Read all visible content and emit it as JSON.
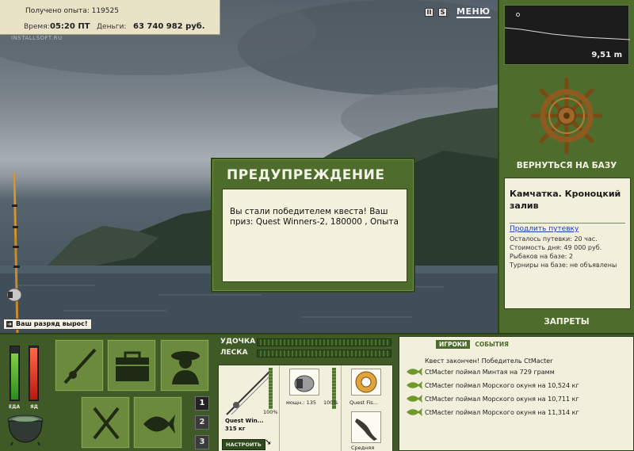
{
  "stats": {
    "experience_label": "Получено опыта: 119525",
    "time_label": "Время:",
    "time_value": "05:20 ПТ",
    "money_label": "Деньги:",
    "money_value": "63 740 982 руб."
  },
  "watermark": "INSTALLSOFT.RU",
  "top_controls": {
    "pause_glyph": "II",
    "sound_glyph": "S",
    "menu_label": "МЕНЮ"
  },
  "rank_notice": "Ваш разряд вырос!",
  "dialog": {
    "title": "ПРЕДУПРЕЖДЕНИЕ",
    "message": "Вы стали победителем квеста! Ваш приз: Quest Winners-2, 180000 , Опыта"
  },
  "depth_gauge": {
    "value": "9,51 m"
  },
  "right_panel": {
    "return_label": "ВЕРНУТЬСЯ НА БАЗУ",
    "location_title": "Камчатка. Кроноцкий залив",
    "extend_link": "Продлить путевку",
    "info": [
      "Осталось путевки: 20 час.",
      "Стоимость дня: 49 000 руб.",
      "Рыбаков на базе: 2",
      "Турниры на базе: не объявлены"
    ],
    "bans_label": "ЗАПРЕТЫ"
  },
  "meters": {
    "food_label": "ЕДА",
    "poison_label": "ЯД",
    "food_level": 0.85,
    "poison_level": 0.95
  },
  "pager": [
    "1",
    "2",
    "3"
  ],
  "tackle": {
    "rod_label": "УДОЧКА",
    "line_label": "ЛЕСКА",
    "rod_name": "Quest Win...",
    "rod_weight": "315 кг",
    "rod_percent": "100%",
    "tune_label": "НАСТРОИТЬ",
    "reel_power": "мощн.: 135",
    "reel_percent": "100%",
    "line_name": "Quest Fis...",
    "bait_name": "Средняя",
    "rod_condition": 1.0,
    "reel_condition": 1.0
  },
  "events": {
    "tab_players": "ИГРОКИ",
    "tab_events": "СОБЫТИЯ",
    "items": [
      "Квест закончен! Победитель CtMacter",
      "CtMacter поймал Минтая на 729 грамм",
      "CtMacter поймал Морского окуня на 10,524 кг",
      "CtMacter поймал Морского окуня на 10,711 кг",
      "CtMacter поймал Морского окуня на 11,314 кг"
    ]
  },
  "colors": {
    "panel_green": "#4e6d2c",
    "dark_green": "#3f5a26",
    "cream": "#f2efdd",
    "link_blue": "#1e3fb5"
  }
}
